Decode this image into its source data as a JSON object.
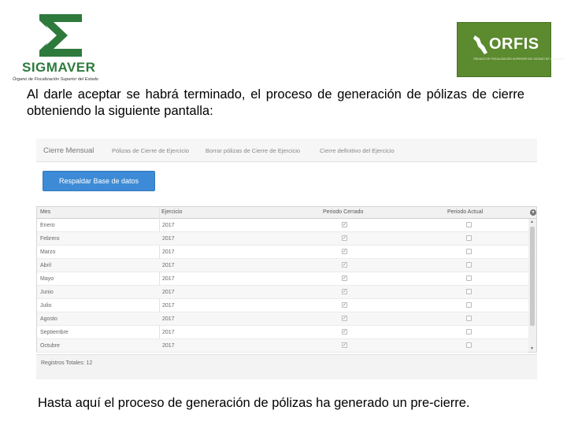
{
  "header": {
    "left_logo": {
      "brand": "SIGMAVER",
      "org": "Órgano de Fiscalización Superior del Estado",
      "color": "#2e7a3d"
    },
    "right_logo": {
      "brand": "ORFIS",
      "sub": "ÓRGANO DE FISCALIZACIÓN SUPERIOR DEL ESTADO DE VERACRUZ",
      "color": "#5b8a2f"
    }
  },
  "intro_text": "Al darle aceptar se habrá terminado, el proceso de generación de pólizas de cierre obteniendo la siguiente pantalla:",
  "app": {
    "brand": "Cierre Mensual",
    "nav": [
      "Pólizas de Cierre de Ejercicio",
      "Borrar pólizas de Cierre de Ejercicio",
      "Cierre definitivo del Ejercicio"
    ],
    "backup_button": "Respaldar Base de datos",
    "columns": [
      "Mes",
      "Ejercicio",
      "Periodo Cerrado",
      "Periodo Actual"
    ],
    "rows": [
      {
        "mes": "Enero",
        "ejercicio": "2017",
        "cerrado": "✓",
        "actual": ""
      },
      {
        "mes": "Febrero",
        "ejercicio": "2017",
        "cerrado": "✓",
        "actual": ""
      },
      {
        "mes": "Marzo",
        "ejercicio": "2017",
        "cerrado": "✓",
        "actual": ""
      },
      {
        "mes": "Abril",
        "ejercicio": "2017",
        "cerrado": "✓",
        "actual": ""
      },
      {
        "mes": "Mayo",
        "ejercicio": "2017",
        "cerrado": "✓",
        "actual": ""
      },
      {
        "mes": "Junio",
        "ejercicio": "2017",
        "cerrado": "✓",
        "actual": ""
      },
      {
        "mes": "Julio",
        "ejercicio": "2017",
        "cerrado": "✓",
        "actual": ""
      },
      {
        "mes": "Agosto",
        "ejercicio": "2017",
        "cerrado": "✓",
        "actual": ""
      },
      {
        "mes": "Septiembre",
        "ejercicio": "2017",
        "cerrado": "✓",
        "actual": ""
      },
      {
        "mes": "Octubre",
        "ejercicio": "2017",
        "cerrado": "✓",
        "actual": ""
      }
    ],
    "totals": "Registros Totales: 12",
    "accent_color": "#3d8bd6"
  },
  "conclusion_text": "Hasta aquí el proceso de generación de pólizas ha generado un pre-cierre."
}
